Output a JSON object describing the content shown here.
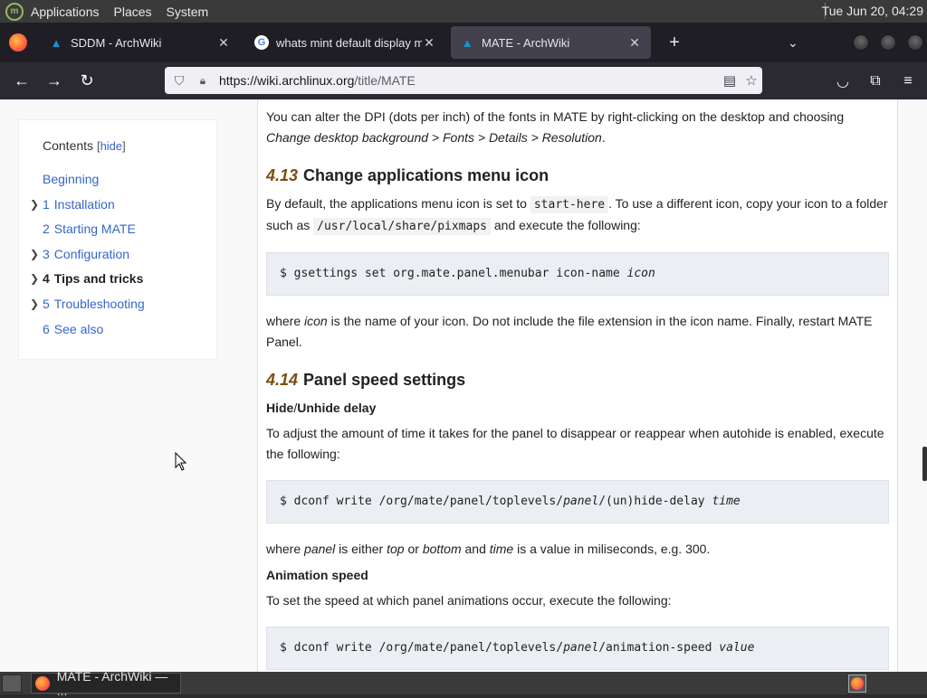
{
  "top_panel": {
    "menus": [
      "Applications",
      "Places",
      "System"
    ],
    "clock": "Tue Jun 20, 04:29"
  },
  "tabs": [
    {
      "title": "SDDM - ArchWiki",
      "favicon": "archwiki-icon",
      "active": false
    },
    {
      "title": "whats mint default display m",
      "favicon": "google-icon",
      "active": false
    },
    {
      "title": "MATE - ArchWiki",
      "favicon": "archwiki-icon",
      "active": true
    }
  ],
  "navbar": {
    "url_prefix": "https://wiki.",
    "url_domain": "archlinux.org",
    "url_path": "/title/MATE"
  },
  "toc": {
    "heading": "Contents",
    "hide_label": "hide",
    "items": [
      {
        "num": "",
        "label": "Beginning",
        "expandable": false,
        "active": false
      },
      {
        "num": "1",
        "label": "Installation",
        "expandable": true,
        "active": false
      },
      {
        "num": "2",
        "label": "Starting MATE",
        "expandable": false,
        "active": false
      },
      {
        "num": "3",
        "label": "Configuration",
        "expandable": true,
        "active": false
      },
      {
        "num": "4",
        "label": "Tips and tricks",
        "expandable": true,
        "active": true
      },
      {
        "num": "5",
        "label": "Troubleshooting",
        "expandable": true,
        "active": false
      },
      {
        "num": "6",
        "label": "See also",
        "expandable": false,
        "active": false
      }
    ]
  },
  "article": {
    "intro_text_1": "You can alter the DPI (dots per inch) of the fonts in MATE by right-clicking on the desktop and choosing ",
    "intro_italic": "Change desktop background > Fonts > Details > Resolution",
    "intro_text_2": ".",
    "s413_num": "4.13",
    "s413_title": "Change applications menu icon",
    "s413_p1_a": "By default, the applications menu icon is set to ",
    "s413_p1_code1": "start-here",
    "s413_p1_b": ". To use a different icon, copy your icon to a folder such as ",
    "s413_p1_code2": "/usr/local/share/pixmaps",
    "s413_p1_c": " and execute the following:",
    "s413_code": "$ gsettings set org.mate.panel.menubar icon-name ",
    "s413_code_var": "icon",
    "s413_p2_a": "where ",
    "s413_p2_var": "icon",
    "s413_p2_b": " is the name of your icon. Do not include the file extension in the icon name. Finally, restart MATE Panel.",
    "s414_num": "4.14",
    "s414_title": "Panel speed settings",
    "h_hide_a": "Hide",
    "h_hide_sep": "/",
    "h_hide_b": "Unhide delay",
    "s414_p1": "To adjust the amount of time it takes for the panel to disappear or reappear when autohide is enabled, execute the following:",
    "s414_code1_a": "$ dconf write /org/mate/panel/toplevels/",
    "s414_code1_var1": "panel",
    "s414_code1_b": "/(un)hide-delay ",
    "s414_code1_var2": "time",
    "s414_p2_a": "where ",
    "s414_p2_v1": "panel",
    "s414_p2_b": " is either ",
    "s414_p2_v2": "top",
    "s414_p2_c": " or ",
    "s414_p2_v3": "bottom",
    "s414_p2_d": " and ",
    "s414_p2_v4": "time",
    "s414_p2_e": " is a value in miliseconds, e.g. 300.",
    "h_anim": "Animation speed",
    "s414_p3": "To set the speed at which panel animations occur, execute the following:",
    "s414_code2_a": "$ dconf write /org/mate/panel/toplevels/",
    "s414_code2_var1": "panel",
    "s414_code2_b": "/animation-speed ",
    "s414_code2_var2": "value"
  },
  "taskbar": {
    "task_title": "MATE - ArchWiki — ..."
  }
}
